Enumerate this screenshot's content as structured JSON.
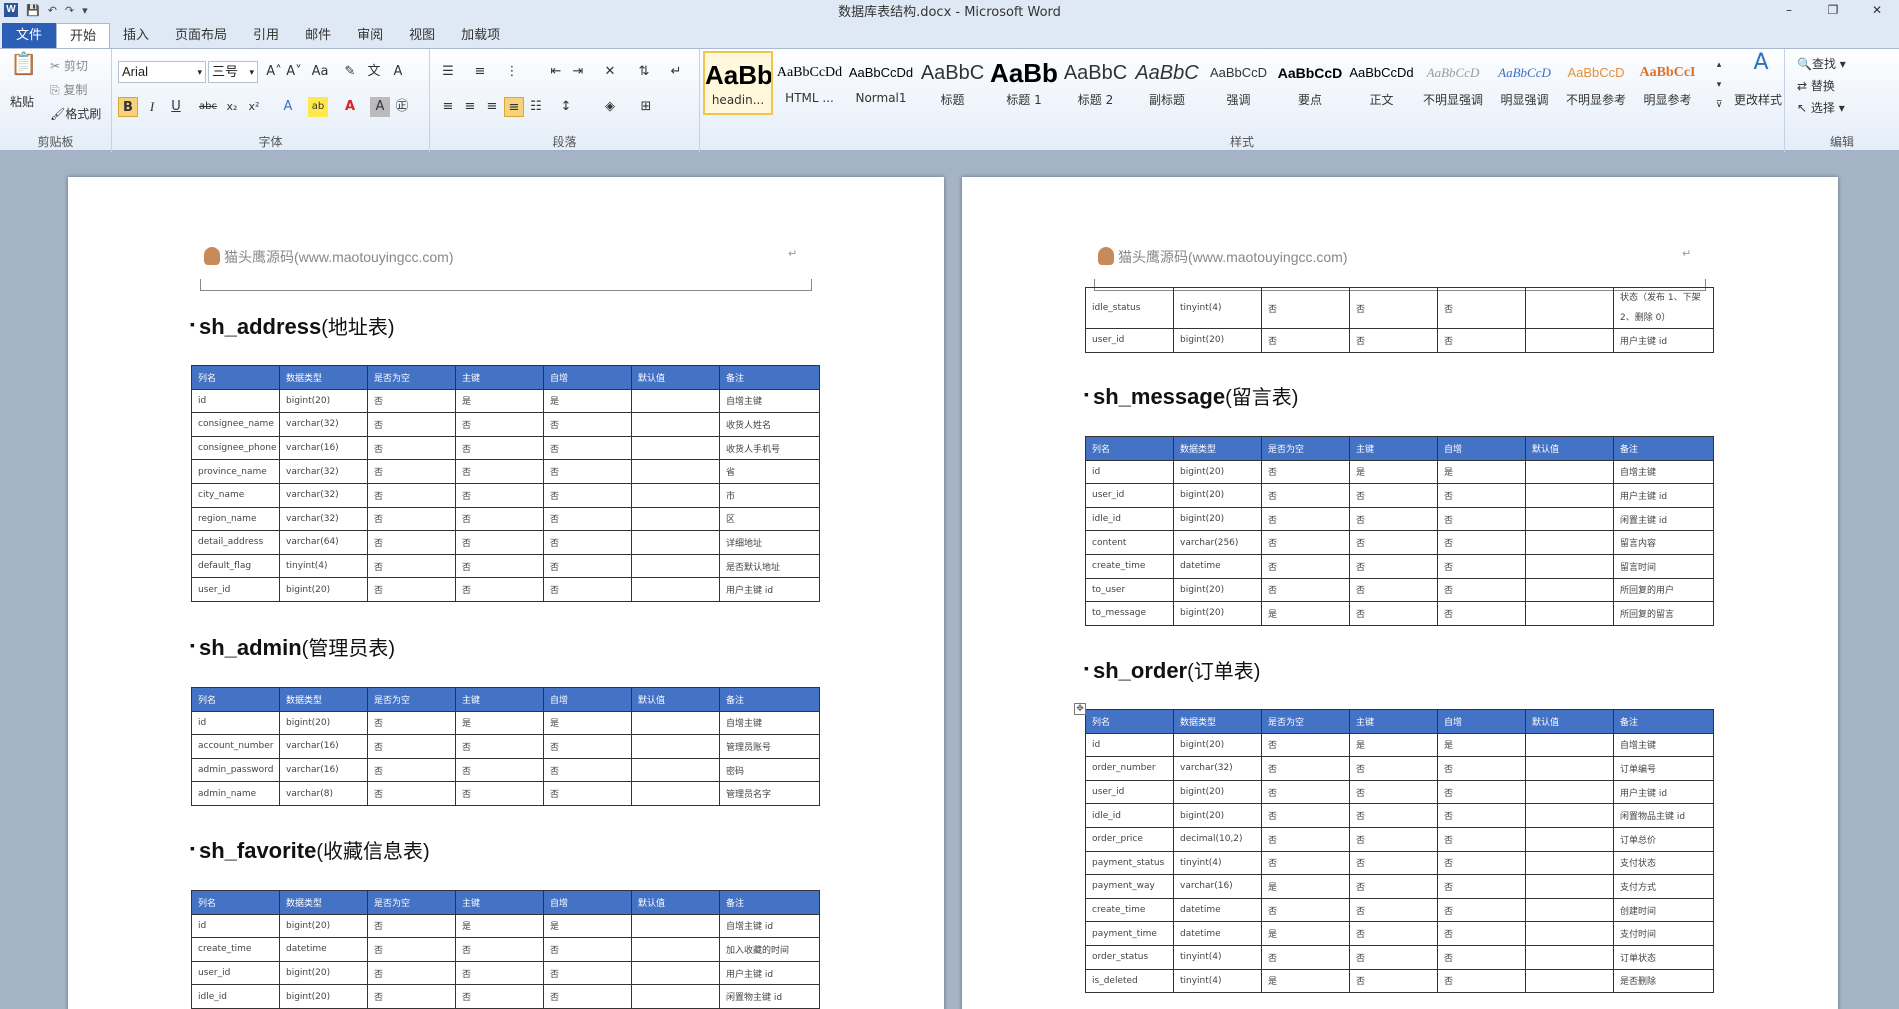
{
  "window": {
    "title": "数据库表结构.docx - Microsoft Word",
    "controls": [
      "–",
      "❐",
      "✕"
    ]
  },
  "qat": {
    "undo": "↶",
    "redo": "↷",
    "customize": "▾"
  },
  "tabs": [
    "文件",
    "开始",
    "插入",
    "页面布局",
    "引用",
    "邮件",
    "审阅",
    "视图",
    "加载项"
  ],
  "ribbon": {
    "clipboard": {
      "paste": "粘贴",
      "cut": "剪切",
      "copy": "复制",
      "format_painter": "格式刷",
      "label": "剪贴板"
    },
    "font": {
      "name": "Arial",
      "size": "三号",
      "label": "字体"
    },
    "paragraph": {
      "label": "段落"
    },
    "styles": {
      "label": "样式",
      "change": "更改样式",
      "items": [
        {
          "preview": "AaBb(",
          "name": "headin..."
        },
        {
          "preview": "AaBbCcDd",
          "name": "HTML ..."
        },
        {
          "preview": "AaBbCcDd",
          "name": "Normal1"
        },
        {
          "preview": "AaBbC",
          "name": "标题"
        },
        {
          "preview": "AaBb",
          "name": "标题 1"
        },
        {
          "preview": "AaBbC",
          "name": "标题 2"
        },
        {
          "preview": "AaBbC",
          "name": "副标题"
        },
        {
          "preview": "AaBbCcD",
          "name": "强调"
        },
        {
          "preview": "AaBbCcD",
          "name": "要点"
        },
        {
          "preview": "AaBbCcDd",
          "name": "正文"
        },
        {
          "preview": "AaBbCcD",
          "name": "不明显强调"
        },
        {
          "preview": "AaBbCcD",
          "name": "明显强调"
        },
        {
          "preview": "AaBbCcD",
          "name": "不明显参考"
        },
        {
          "preview": "AaBbCcI",
          "name": "明显参考"
        }
      ]
    },
    "editing": {
      "find": "查找",
      "replace": "替换",
      "select": "选择",
      "label": "编辑"
    }
  },
  "doc": {
    "header_text": "猫头鹰源码(www.maotouyingcc.com)",
    "columns": [
      "列名",
      "数据类型",
      "是否为空",
      "主键",
      "自增",
      "默认值",
      "备注"
    ],
    "left": {
      "tables": [
        {
          "name": "sh_address",
          "cn": "(地址表)",
          "rows": [
            [
              "id",
              "bigint(20)",
              "否",
              "是",
              "是",
              "",
              "自增主键"
            ],
            [
              "consignee_name",
              "varchar(32)",
              "否",
              "否",
              "否",
              "",
              "收货人姓名"
            ],
            [
              "consignee_phone",
              "varchar(16)",
              "否",
              "否",
              "否",
              "",
              "收货人手机号"
            ],
            [
              "province_name",
              "varchar(32)",
              "否",
              "否",
              "否",
              "",
              "省"
            ],
            [
              "city_name",
              "varchar(32)",
              "否",
              "否",
              "否",
              "",
              "市"
            ],
            [
              "region_name",
              "varchar(32)",
              "否",
              "否",
              "否",
              "",
              "区"
            ],
            [
              "detail_address",
              "varchar(64)",
              "否",
              "否",
              "否",
              "",
              "详细地址"
            ],
            [
              "default_flag",
              "tinyint(4)",
              "否",
              "否",
              "否",
              "",
              "是否默认地址"
            ],
            [
              "user_id",
              "bigint(20)",
              "否",
              "否",
              "否",
              "",
              "用户主键 id"
            ]
          ]
        },
        {
          "name": "sh_admin",
          "cn": "(管理员表)",
          "rows": [
            [
              "id",
              "bigint(20)",
              "否",
              "是",
              "是",
              "",
              "自增主键"
            ],
            [
              "account_number",
              "varchar(16)",
              "否",
              "否",
              "否",
              "",
              "管理员账号"
            ],
            [
              "admin_password",
              "varchar(16)",
              "否",
              "否",
              "否",
              "",
              "密码"
            ],
            [
              "admin_name",
              "varchar(8)",
              "否",
              "否",
              "否",
              "",
              "管理员名字"
            ]
          ]
        },
        {
          "name": "sh_favorite",
          "cn": "(收藏信息表)",
          "rows": [
            [
              "id",
              "bigint(20)",
              "否",
              "是",
              "是",
              "",
              "自增主键 id"
            ],
            [
              "create_time",
              "datetime",
              "否",
              "否",
              "否",
              "",
              "加入收藏的时间"
            ],
            [
              "user_id",
              "bigint(20)",
              "否",
              "否",
              "否",
              "",
              "用户主键 id"
            ],
            [
              "idle_id",
              "bigint(20)",
              "否",
              "否",
              "否",
              "",
              "闲置物主键 id"
            ]
          ]
        }
      ]
    },
    "right": {
      "cont_rows": [
        [
          "idle_status",
          "tinyint(4)",
          "否",
          "否",
          "否",
          "",
          "状态（发布 1、下架2、删除 0）"
        ],
        [
          "user_id",
          "bigint(20)",
          "否",
          "否",
          "否",
          "",
          "用户主键 id"
        ]
      ],
      "tables": [
        {
          "name": "sh_message",
          "cn": "(留言表)",
          "rows": [
            [
              "id",
              "bigint(20)",
              "否",
              "是",
              "是",
              "",
              "自增主键"
            ],
            [
              "user_id",
              "bigint(20)",
              "否",
              "否",
              "否",
              "",
              "用户主键 id"
            ],
            [
              "idle_id",
              "bigint(20)",
              "否",
              "否",
              "否",
              "",
              "闲置主键 id"
            ],
            [
              "content",
              "varchar(256)",
              "否",
              "否",
              "否",
              "",
              "留言内容"
            ],
            [
              "create_time",
              "datetime",
              "否",
              "否",
              "否",
              "",
              "留言时间"
            ],
            [
              "to_user",
              "bigint(20)",
              "否",
              "否",
              "否",
              "",
              "所回复的用户"
            ],
            [
              "to_message",
              "bigint(20)",
              "是",
              "否",
              "否",
              "",
              "所回复的留言"
            ]
          ]
        },
        {
          "name": "sh_order",
          "cn": "(订单表)",
          "rows": [
            [
              "id",
              "bigint(20)",
              "否",
              "是",
              "是",
              "",
              "自增主键"
            ],
            [
              "order_number",
              "varchar(32)",
              "否",
              "否",
              "否",
              "",
              "订单编号"
            ],
            [
              "user_id",
              "bigint(20)",
              "否",
              "否",
              "否",
              "",
              "用户主键 id"
            ],
            [
              "idle_id",
              "bigint(20)",
              "否",
              "否",
              "否",
              "",
              "闲置物品主键 id"
            ],
            [
              "order_price",
              "decimal(10,2)",
              "否",
              "否",
              "否",
              "",
              "订单总价"
            ],
            [
              "payment_status",
              "tinyint(4)",
              "否",
              "否",
              "否",
              "",
              "支付状态"
            ],
            [
              "payment_way",
              "varchar(16)",
              "是",
              "否",
              "否",
              "",
              "支付方式"
            ],
            [
              "create_time",
              "datetime",
              "否",
              "否",
              "否",
              "",
              "创建时间"
            ],
            [
              "payment_time",
              "datetime",
              "是",
              "否",
              "否",
              "",
              "支付时间"
            ],
            [
              "order_status",
              "tinyint(4)",
              "否",
              "否",
              "否",
              "",
              "订单状态"
            ],
            [
              "is_deleted",
              "tinyint(4)",
              "是",
              "否",
              "否",
              "",
              "是否删除"
            ]
          ]
        }
      ]
    }
  },
  "colors": {
    "table_header": "#4472c4",
    "file_tab": "#2b5fb5",
    "workspace": "#a4b3c6"
  }
}
